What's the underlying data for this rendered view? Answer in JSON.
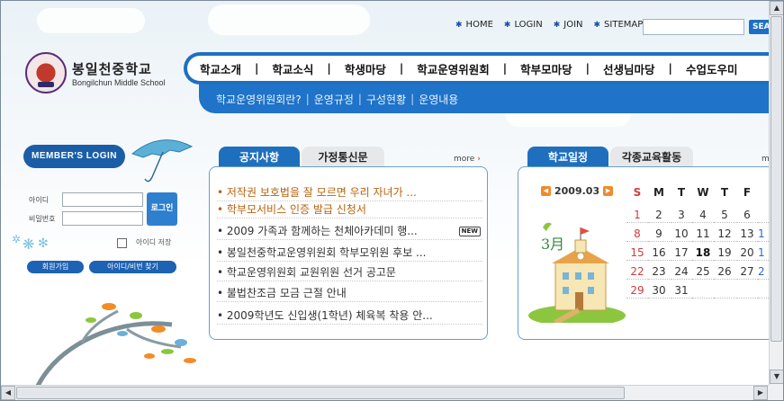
{
  "top_links": [
    "HOME",
    "LOGIN",
    "JOIN",
    "SITEMAP"
  ],
  "search": {
    "placeholder": "",
    "button_label": "SEA"
  },
  "logo": {
    "name_ko": "봉일천중학교",
    "name_en": "Bongilchun Middle School"
  },
  "main_nav": [
    "학교소개",
    "학교소식",
    "학생마당",
    "학교운영위원회",
    "학부모마당",
    "선생님마당",
    "수업도우미"
  ],
  "sub_nav": [
    "학교운영위원회란?",
    "운영규정",
    "구성현황",
    "운영내용"
  ],
  "member_login": {
    "title": "MEMBER'S LOGIN",
    "id_label": "아이디",
    "pw_label": "비밀번호",
    "login_button": "로그인",
    "save_id_label": "아이디 저장",
    "join_button": "회원가입",
    "find_button": "아이디/비번 찾기"
  },
  "notice": {
    "tab_active": "공지사항",
    "tab_inactive": "가정통신문",
    "more": "more",
    "items": [
      {
        "text": "• 저작권 보호법을 잘 모르면 우리 자녀가 ...",
        "highlight": true,
        "new": false
      },
      {
        "text": "• 학부모서비스 인증 발급 신청서",
        "highlight": true,
        "new": false
      },
      {
        "text": "• 2009 가족과 함께하는 천체아카데미 행...",
        "highlight": false,
        "new": true
      },
      {
        "text": "• 봉일천중학교운영위원회 학부모위원 후보 ...",
        "highlight": false,
        "new": false
      },
      {
        "text": "• 학교운영위원회 교원위원 선거 공고문",
        "highlight": false,
        "new": false
      },
      {
        "text": "• 불법찬조금 모금 근절 안내",
        "highlight": false,
        "new": false
      },
      {
        "text": "• 2009학년도 신입생(1학년) 체육복 착용 안...",
        "highlight": false,
        "new": false
      }
    ],
    "new_badge": "NEW"
  },
  "schedule": {
    "tab_active": "학교일정",
    "tab_inactive": "각종교육활동",
    "more": "m",
    "month_label": "2009.03",
    "illustration_label": "3月",
    "weekdays": [
      "S",
      "M",
      "T",
      "W",
      "T",
      "F"
    ],
    "weeks": [
      [
        "1",
        "2",
        "3",
        "4",
        "5",
        "6"
      ],
      [
        "8",
        "9",
        "10",
        "11",
        "12",
        "13"
      ],
      [
        "15",
        "16",
        "17",
        "18",
        "19",
        "20"
      ],
      [
        "22",
        "23",
        "24",
        "25",
        "26",
        "27"
      ],
      [
        "29",
        "30",
        "31",
        "",
        "",
        ""
      ]
    ],
    "week_overflow": [
      "",
      "1",
      "1",
      "2",
      ""
    ],
    "today": "18"
  },
  "colors": {
    "brand_blue": "#1f6fbf",
    "accent_orange": "#f08a2c",
    "sunday_red": "#d23c3c"
  }
}
